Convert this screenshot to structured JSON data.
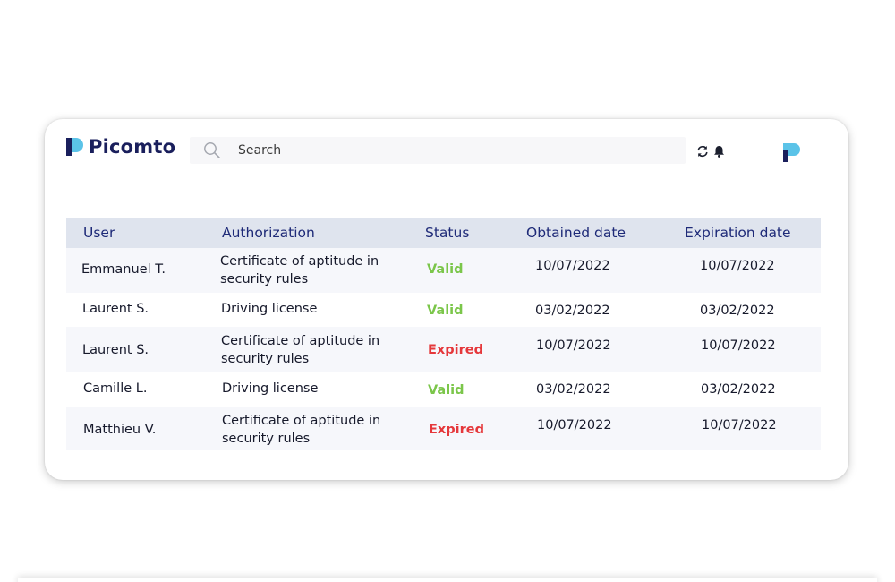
{
  "header": {
    "brand": "Picomto",
    "search_placeholder": "Search",
    "brand_colors": {
      "dark": "#1a1f5c",
      "accent": "#5bc3e8"
    }
  },
  "table": {
    "columns": [
      "User",
      "Authorization",
      "Status",
      "Obtained date",
      "Expiration date"
    ],
    "rows": [
      {
        "user": "Emmanuel T.",
        "authorization": "Certificate of aptitude in security rules",
        "status": "Valid",
        "obtained": "10/07/2022",
        "expiration": "10/07/2022"
      },
      {
        "user": "Laurent S.",
        "authorization": "Driving license",
        "status": "Valid",
        "obtained": "03/02/2022",
        "expiration": "03/02/2022"
      },
      {
        "user": "Laurent S.",
        "authorization": "Certificate of aptitude in security rules",
        "status": "Expired",
        "obtained": "10/07/2022",
        "expiration": "10/07/2022"
      },
      {
        "user": "Camille L.",
        "authorization": "Driving license",
        "status": "Valid",
        "obtained": "03/02/2022",
        "expiration": "03/02/2022"
      },
      {
        "user": "Matthieu V.",
        "authorization": "Certificate of aptitude in security rules",
        "status": "Expired",
        "obtained": "10/07/2022",
        "expiration": "10/07/2022"
      }
    ],
    "status_colors": {
      "Valid": "#7bc64a",
      "Expired": "#e5383b"
    }
  },
  "icons": {
    "search": "search-icon",
    "refresh": "refresh-icon",
    "notifications": "bell-icon",
    "profile": "avatar"
  }
}
